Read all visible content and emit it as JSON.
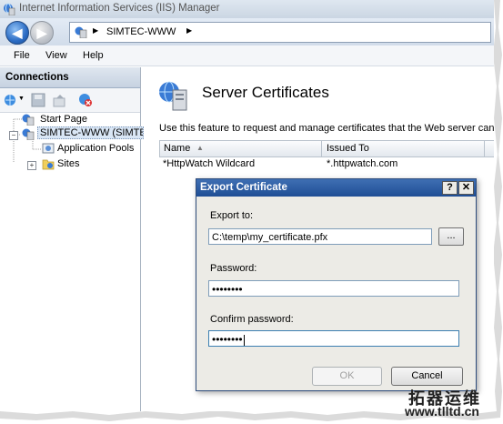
{
  "window": {
    "title": "Internet Information Services (IIS) Manager"
  },
  "address": {
    "crumb": "SIMTEC-WWW"
  },
  "menu": {
    "items": [
      "File",
      "View",
      "Help"
    ]
  },
  "connections": {
    "title": "Connections",
    "tree": {
      "start_page": "Start Page",
      "server": "SIMTEC-WWW (SIMTE",
      "app_pools": "Application Pools",
      "sites": "Sites"
    }
  },
  "main": {
    "title": "Server Certificates",
    "description": "Use this feature to request and manage certificates that the Web server can",
    "columns": {
      "name": "Name",
      "issued_to": "Issued To"
    },
    "rows": [
      {
        "name": "*HttpWatch Wildcard",
        "issued_to": "*.httpwatch.com"
      }
    ]
  },
  "dialog": {
    "title": "Export Certificate",
    "help_btn": "?",
    "close_btn": "✕",
    "export_label": "Export to:",
    "export_value": "C:\\temp\\my_certificate.pfx",
    "browse_label": "...",
    "password_label": "Password:",
    "password_value": "••••••••",
    "confirm_label": "Confirm password:",
    "confirm_value": "••••••••",
    "ok_label": "OK",
    "cancel_label": "Cancel"
  },
  "watermark": {
    "line1": "拓器运维",
    "line2": "www.tlltd.cn"
  }
}
